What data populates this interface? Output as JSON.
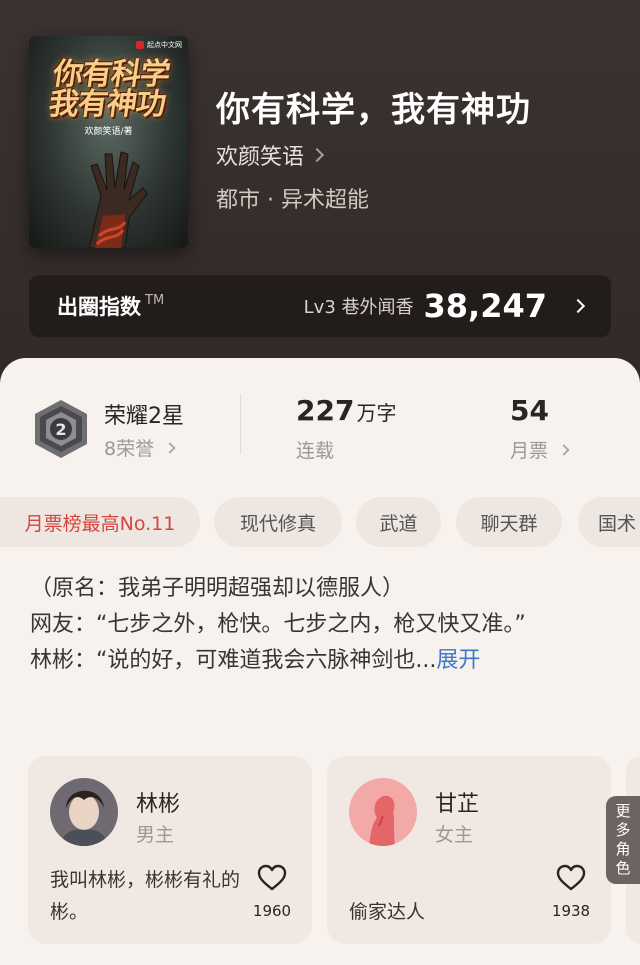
{
  "book": {
    "cover": {
      "publisher": "起点中文网",
      "title_art": "你有科学 我有神功",
      "author_art": "欢颜笑语/著"
    },
    "title": "你有科学，我有神功",
    "author": "欢颜笑语",
    "genre": "都市 · 异术超能"
  },
  "circle_index": {
    "label": "出圈指数",
    "tm": "TM",
    "level": "Lv3 巷外闻香",
    "score": "38,247"
  },
  "stats": {
    "honor_title": "荣耀2星",
    "honor_sub": "8荣誉",
    "badge_number": "2",
    "words_num": "227",
    "words_unit": "万字",
    "status": "连载",
    "monthly_tickets": "54",
    "monthly_tickets_label": "月票"
  },
  "tags": [
    "月票榜最高No.11",
    "现代修真",
    "武道",
    "聊天群",
    "国术"
  ],
  "synopsis": {
    "line1": "（原名：我弟子明明超强却以德服人）",
    "line2": "网友：“七步之外，枪快。七步之内，枪又快又准。”",
    "line3": "林彬：“说的好，可难道我会六脉神剑也...",
    "expand": "展开"
  },
  "characters": [
    {
      "name": "林彬",
      "role": "男主",
      "desc": "我叫林彬，彬彬有礼的彬。",
      "likes": "1960"
    },
    {
      "name": "甘芷",
      "role": "女主",
      "desc": "偷家达人",
      "likes": "1938"
    }
  ],
  "more_roles": "更多角色",
  "colors": {
    "accent_red": "#d8453c",
    "link_blue": "#3d79c7",
    "header_bg": "#2f2826"
  }
}
